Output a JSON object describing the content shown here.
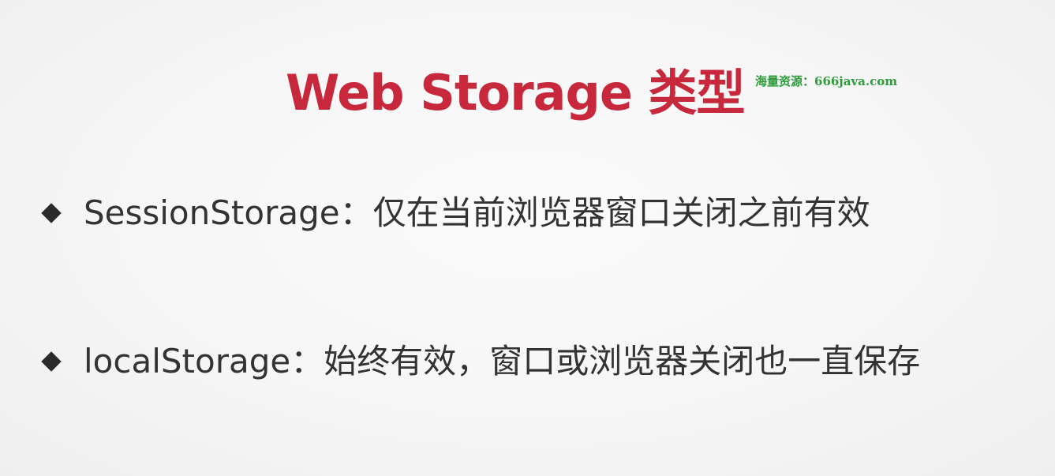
{
  "slide": {
    "title": "Web Storage 类型",
    "watermark": "海量资源：666java.com",
    "bullets": [
      {
        "icon": "diamond-bullet-icon",
        "text": "SessionStorage：仅在当前浏览器窗口关闭之前有效"
      },
      {
        "icon": "diamond-bullet-icon",
        "text": "localStorage：始终有效，窗口或浏览器关闭也一直保存"
      }
    ]
  },
  "colors": {
    "title": "#c8283b",
    "watermark": "#2e9c3a",
    "text": "#333333",
    "background": "#f7f7f7"
  }
}
